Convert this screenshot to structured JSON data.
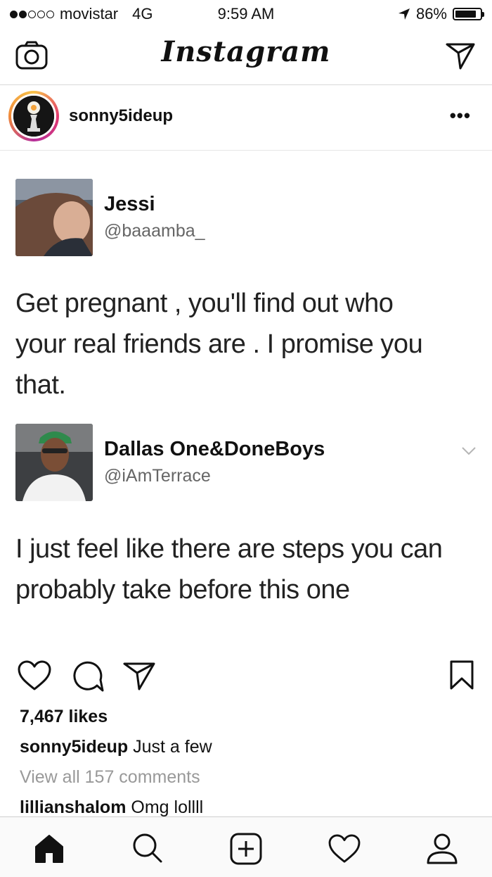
{
  "status_bar": {
    "carrier": "movistar",
    "network": "4G",
    "time": "9:59 AM",
    "battery": "86%",
    "battery_level": 0.86
  },
  "header": {
    "title": "Instagram"
  },
  "post": {
    "username": "sonny5ideup",
    "more": "•••",
    "tweets": [
      {
        "name": "Jessi",
        "handle": "@baaamba_",
        "lines": [
          "Get pregnant , you'll find out who",
          "your real friends are . I promise you",
          "that."
        ]
      },
      {
        "name": "Dallas One&DoneBoys",
        "handle": "@iAmTerrace",
        "lines": [
          "I just feel like there are steps you can",
          "probably take before this one"
        ]
      }
    ],
    "likes": "7,467 likes",
    "caption_user": "sonny5ideup",
    "caption_text": "Just a few",
    "view_all": "View all 157 comments",
    "comment_user": "lillianshalom",
    "comment_text": "Omg lollll"
  },
  "icons": [
    "camera-icon",
    "send-icon",
    "heart-icon",
    "comment-icon",
    "bookmark-icon",
    "home-icon",
    "search-icon",
    "add-icon",
    "activity-icon",
    "profile-icon"
  ]
}
